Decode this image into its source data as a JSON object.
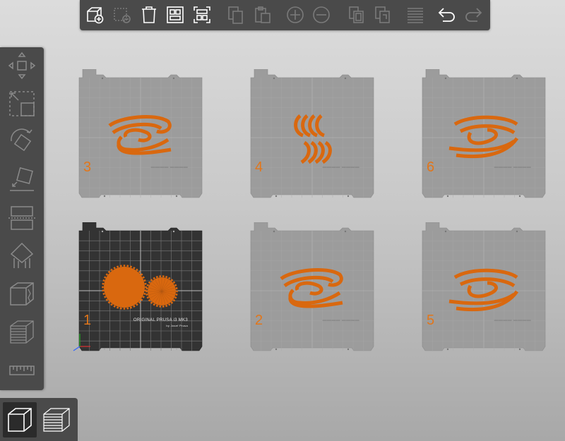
{
  "toolbar": {
    "buttons": [
      {
        "name": "add-object-button",
        "icon": "add-cube-icon",
        "enabled": true
      },
      {
        "name": "delete-button",
        "icon": "delete-object-icon",
        "enabled": false
      },
      {
        "name": "delete-all-button",
        "icon": "trash-icon",
        "enabled": true
      },
      {
        "name": "arrange-button",
        "icon": "arrange-icon",
        "enabled": true
      },
      {
        "name": "arrange-selection-button",
        "icon": "arrange-selection-icon",
        "enabled": true
      },
      {
        "name": "copy-button",
        "icon": "copy-icon",
        "enabled": false
      },
      {
        "name": "paste-button",
        "icon": "paste-icon",
        "enabled": false
      },
      {
        "name": "add-instance-button",
        "icon": "plus-circle-icon",
        "enabled": false
      },
      {
        "name": "remove-instance-button",
        "icon": "minus-circle-icon",
        "enabled": false
      },
      {
        "name": "split-objects-button",
        "icon": "split-objects-icon",
        "enabled": false
      },
      {
        "name": "split-parts-button",
        "icon": "split-parts-icon",
        "enabled": false
      },
      {
        "name": "layers-editing-button",
        "icon": "layers-icon",
        "enabled": false
      },
      {
        "name": "undo-button",
        "icon": "undo-icon",
        "enabled": true
      },
      {
        "name": "redo-button",
        "icon": "redo-icon",
        "enabled": false
      }
    ]
  },
  "sidebar": {
    "tools": [
      {
        "name": "move-tool",
        "icon": "move-arrows-icon"
      },
      {
        "name": "scale-tool",
        "icon": "scale-icon"
      },
      {
        "name": "rotate-tool",
        "icon": "rotate-icon"
      },
      {
        "name": "place-on-face-tool",
        "icon": "place-on-face-icon"
      },
      {
        "name": "cut-tool",
        "icon": "cut-icon"
      },
      {
        "name": "support-painting-tool",
        "icon": "support-paint-icon"
      },
      {
        "name": "seam-painting-tool",
        "icon": "seam-paint-icon"
      },
      {
        "name": "variable-layer-tool",
        "icon": "layer-height-icon"
      },
      {
        "name": "measure-tool",
        "icon": "ruler-icon"
      }
    ]
  },
  "view_switcher": {
    "items": [
      {
        "name": "3d-view-button",
        "icon": "cube-icon",
        "active": true
      },
      {
        "name": "preview-button",
        "icon": "layers-stack-icon",
        "active": false
      }
    ]
  },
  "colors": {
    "accent": "#e2761a",
    "object": "#d9680f",
    "panel": "#4a4a4a",
    "plate_inactive": "#9c9c9c",
    "plate_active": "#333333"
  },
  "plates": [
    {
      "number": "3",
      "active": false,
      "objects": "swirl"
    },
    {
      "number": "4",
      "active": false,
      "objects": "arcs"
    },
    {
      "number": "6",
      "active": false,
      "objects": "swirl2"
    },
    {
      "number": "1",
      "active": true,
      "objects": "gears",
      "brand": "ORIGINAL PRUSA i3 MK3",
      "brand_sub": "by Josef Prusa"
    },
    {
      "number": "2",
      "active": false,
      "objects": "swirl"
    },
    {
      "number": "5",
      "active": false,
      "objects": "swirl2"
    }
  ]
}
